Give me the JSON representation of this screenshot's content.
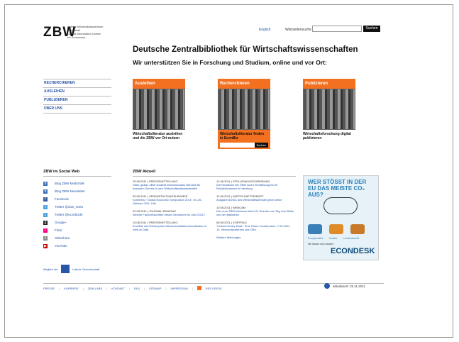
{
  "header": {
    "logo": "ZBW",
    "logo_lines": [
      "Leibniz-Informationszentrum",
      "Wirtschaft",
      "Leibniz Information Centre",
      "for Economics"
    ],
    "lang_link": "English",
    "search_label": "Webseitensuche",
    "search_value": "",
    "search_button": "Suchen"
  },
  "hero": {
    "title": "Deutsche Zentralbibliothek für Wirtschaftswissenschaften",
    "subtitle": "Wir unterstützen Sie in Forschung und Studium, online und vor Ort:"
  },
  "nav": {
    "items": [
      "RECHERCHIEREN",
      "AUSLEIHEN",
      "PUBLIZIEREN",
      "ÜBER UNS"
    ]
  },
  "tiles": [
    {
      "label": "Ausleihen",
      "caption": "Wirtschaftsliteratur ausleihen und die ZBW vor Ort nutzen"
    },
    {
      "label": "Recherchieren",
      "caption": "Wirtschaftsliteratur finden in EconBiz",
      "button": "Suchen"
    },
    {
      "label": "Publizieren",
      "caption": "Wirtschaftsforschung digital publizieren"
    }
  ],
  "social": {
    "title": "ZBW im Social Web",
    "items": [
      "Blog ZBW MediaTalk",
      "Blog ZBW-Newsletter",
      "Facebook",
      "Twitter @zbw_news",
      "Twitter @econbizde",
      "Google+",
      "Flickr",
      "Slideshare",
      "YouTube"
    ],
    "badges": [
      "Mitglied der",
      "Leibniz-Gemeinschaft"
    ]
  },
  "news": {
    "title": "ZBW Aktuell",
    "left": [
      {
        "meta": "25.08.2011 | PRESSEMITTEILUNG",
        "text": "Stark global: ZBW schließt internationales Bündnis für besseren Service in den Wirtschaftswissenschaften"
      },
      {
        "meta": "25.08.2011 | VERANSTALTUNGSHINWEIS",
        "text": "Konferenz \"Global Economic Symposium 2011\" 04.-06. Oktober 2011, Kiel"
      },
      {
        "meta": "22.08.2011 | JOURNAL RANKING",
        "text": "Welche Fachzeitschriften lesen Ökonomen im Jahr 2011?"
      },
      {
        "meta": "15.08.2011 | PRESSEMITTEILUNG",
        "text": "EconBiz mit Schwerpunkt Wissenschaftskommunikation im Web et Data"
      }
    ],
    "right": [
      {
        "meta": "12.08.2011 | STELLENAUSSCHREIBUNG",
        "text": "Die Redaktion der ZBW sucht Verstärkung für ihr Redaktionsteam in Hamburg"
      },
      {
        "meta": "12.08.2011 | WIRTSCHAFTSDIENST",
        "text": "Ausgabe 8/2011 des Wirtschaftsdienstes jetzt online"
      },
      {
        "meta": "10.08.2011 | WEBCAM",
        "text": "Die neue ZBW-Webcam liefert 24 Stunden am Tag Live-Bilder von der Bibliothek"
      },
      {
        "meta": "08.08.2011 | VORTRAG",
        "text": "\"Linked Library Data\". Prof. Klaus Tochtermann, 7.09.2011, 13. Verbundkonferenz des GBV"
      }
    ],
    "more_link": "Weitere Meldungen"
  },
  "ad": {
    "headline": "WER STÖSST IN DER EU DAS MEISTE CO₂ AUS?",
    "item_labels": [
      "Energiesektor",
      "Verkehr",
      "Landwirtschaft"
    ],
    "foot_small": "Wir lassen dich wissen!",
    "brand": "ECONDESK"
  },
  "footer": {
    "links": [
      "PRESSE",
      "KARRIERE",
      "ZBW-LABS",
      "KONTAKT",
      "FAQ",
      "SITEMAP",
      "IMPRESSUM",
      "RSS-FEEDS"
    ],
    "updated": "aktualisiert: 25.11.2011"
  },
  "colors": {
    "accent": "#f37021",
    "link": "#2a56a8",
    "ad_blue": "#2a7fb8"
  }
}
